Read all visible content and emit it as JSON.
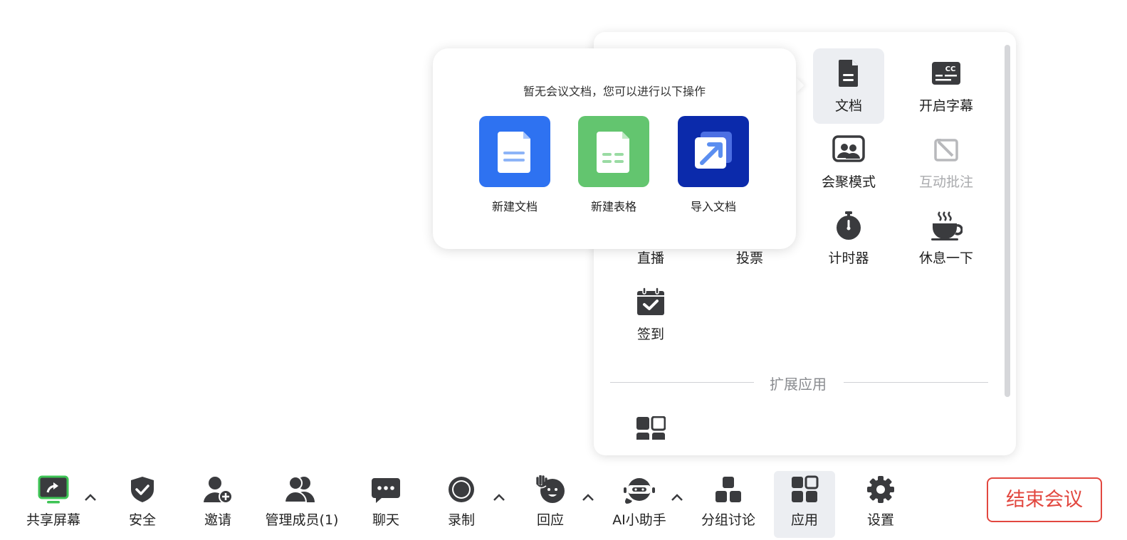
{
  "apps_panel": {
    "items": [
      {
        "label": "文档",
        "icon": "document-icon",
        "active": true
      },
      {
        "label": "开启字幕",
        "icon": "captions-icon"
      },
      {
        "label": "会聚模式",
        "icon": "focus-mode-icon"
      },
      {
        "label": "互动批注",
        "icon": "annotation-icon",
        "disabled": true
      },
      {
        "label": "直播",
        "icon": "live-icon"
      },
      {
        "label": "投票",
        "icon": "vote-icon"
      },
      {
        "label": "计时器",
        "icon": "timer-icon"
      },
      {
        "label": "休息一下",
        "icon": "coffee-icon"
      },
      {
        "label": "签到",
        "icon": "check-in-icon"
      }
    ],
    "extensions_title": "扩展应用",
    "extension_icon": "app-grid-icon"
  },
  "doc_popup": {
    "message": "暂无会议文档，您可以进行以下操作",
    "actions": [
      {
        "label": "新建文档",
        "color": "#2e72f1"
      },
      {
        "label": "新建表格",
        "color": "#63c56f"
      },
      {
        "label": "导入文档",
        "color": "#0b2aab"
      }
    ]
  },
  "toolbar": {
    "items": [
      {
        "label": "共享屏幕",
        "icon": "share-screen-icon",
        "accent": "#3ec455"
      },
      {
        "label": "安全",
        "icon": "shield-icon"
      },
      {
        "label": "邀请",
        "icon": "invite-icon"
      },
      {
        "label": "管理成员(1)",
        "icon": "members-icon"
      },
      {
        "label": "聊天",
        "icon": "chat-icon"
      },
      {
        "label": "录制",
        "icon": "record-icon"
      },
      {
        "label": "回应",
        "icon": "reaction-icon"
      },
      {
        "label": "AI小助手",
        "icon": "ai-assistant-icon"
      },
      {
        "label": "分组讨论",
        "icon": "breakout-icon"
      },
      {
        "label": "应用",
        "icon": "apps-icon",
        "active": true
      },
      {
        "label": "设置",
        "icon": "gear-icon"
      }
    ],
    "end_meeting": "结束会议"
  }
}
